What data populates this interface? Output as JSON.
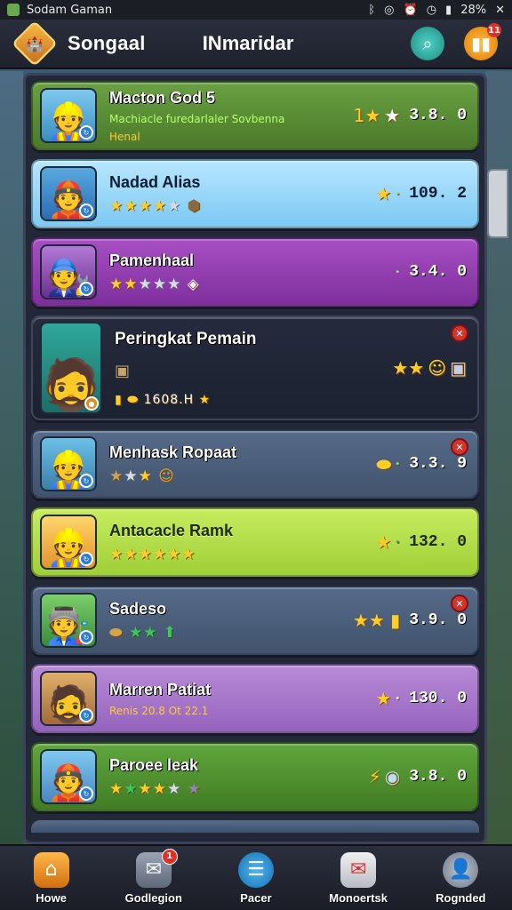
{
  "status_bar": {
    "app_name": "Sodam Gaman",
    "icons": [
      "bluetooth-icon",
      "wifi-icon",
      "alarm-icon",
      "clock-icon",
      "battery-icon"
    ],
    "battery": "28%",
    "close_glyph": "✕"
  },
  "header": {
    "title": "Songaal",
    "subtitle": "INmaridar",
    "search_icon": "search-icon",
    "rank_icon": "ranking-icon",
    "rank_badge": "11"
  },
  "rows": [
    {
      "name": "Macton God 5",
      "sub": "Machiacle furedarlaler Sovbenna",
      "sub2": "Henal",
      "score": "3.8. 0",
      "color": "c-green",
      "stars": "1★★"
    },
    {
      "name": "Nadad Alias",
      "score": "109. 2",
      "color": "c-lightblue"
    },
    {
      "name": "Pamenhaal",
      "score": "3.4. 0",
      "color": "c-purple"
    },
    {
      "name": "Peringkat Pemain",
      "extra": "1608.H",
      "score": "",
      "color": "c-dark"
    },
    {
      "name": "Menhask Ropaat",
      "score": "3.3. 9",
      "color": "c-slate"
    },
    {
      "name": "Antacacle Ramk",
      "score": "132. 0",
      "color": "c-lime"
    },
    {
      "name": "Sadeso",
      "score": "3.9. 0",
      "color": "c-slate"
    },
    {
      "name": "Marren Patiat",
      "sub": "Renis 20.8 Ot 22.1",
      "score": "130. 0",
      "color": "c-lavender"
    },
    {
      "name": "Paroee leak",
      "score": "3.8. 0",
      "color": "c-grass"
    }
  ],
  "nav": [
    {
      "label": "Howe",
      "icon": "home-icon"
    },
    {
      "label": "Godlegion",
      "icon": "chat-icon",
      "badge": "1"
    },
    {
      "label": "Pacer",
      "icon": "menu-icon"
    },
    {
      "label": "Monoertsk",
      "icon": "mail-icon"
    },
    {
      "label": "Rognded",
      "icon": "profile-icon"
    }
  ],
  "colors": {
    "accent": "#ffcd2a",
    "danger": "#d8322c",
    "panel": "#232838"
  }
}
